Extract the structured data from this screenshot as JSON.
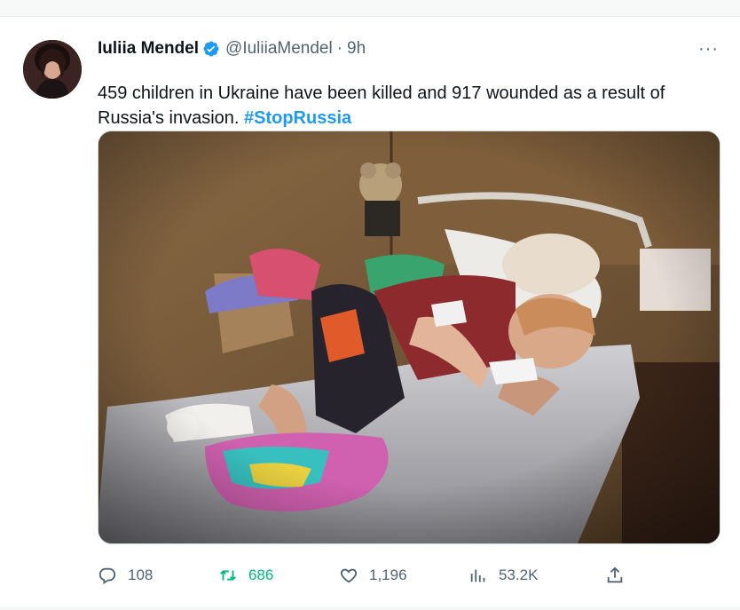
{
  "tweet": {
    "author": {
      "name": "Iuliia Mendel",
      "handle": "@IuliiaMendel",
      "time": "9h"
    },
    "text": {
      "body": "459 children in Ukraine have been killed and 917 wounded as a result of Russia's invasion. ",
      "hashtag": "#StopRussia"
    },
    "more_label": "···",
    "actions": {
      "replies": "108",
      "retweets": "686",
      "likes": "1,196",
      "views": "53.2K"
    }
  },
  "colors": {
    "accent": "#1d9bf0",
    "retweet_green": "#00ba7c",
    "text_primary": "#0f1419",
    "text_secondary": "#536471"
  },
  "icons": {
    "verified": "verified-badge-icon",
    "more": "more-icon",
    "reply": "reply-icon",
    "retweet": "retweet-icon",
    "like": "heart-icon",
    "views": "views-chart-icon",
    "share": "share-icon"
  }
}
